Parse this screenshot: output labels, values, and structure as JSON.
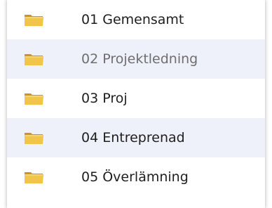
{
  "folders": [
    {
      "label": "01 Gemensamt",
      "icon": "folder-icon",
      "muted": false
    },
    {
      "label": "02 Projektledning",
      "icon": "folder-icon",
      "muted": true
    },
    {
      "label": "03 Proj",
      "icon": "folder-icon",
      "muted": false
    },
    {
      "label": "04 Entreprenad",
      "icon": "folder-icon",
      "muted": false
    },
    {
      "label": "05 Överlämning",
      "icon": "folder-icon",
      "muted": false
    }
  ],
  "colors": {
    "folder_fill": "#f1c54a",
    "folder_dark": "#c9991e",
    "row_alt": "#eef1fa",
    "text": "#1e1e1e",
    "text_muted": "#6e6e6e"
  }
}
